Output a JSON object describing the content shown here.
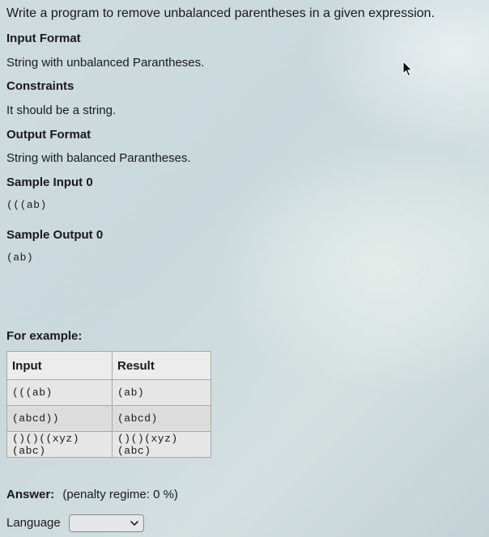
{
  "problem": {
    "statement": "Write a program to remove unbalanced parentheses in a given expression.",
    "input_format_heading": "Input Format",
    "input_format_text": "String with unbalanced Parantheses.",
    "constraints_heading": "Constraints",
    "constraints_text": "It should be a string.",
    "output_format_heading": "Output Format",
    "output_format_text": "String with balanced Parantheses.",
    "sample_input_heading": "Sample Input 0",
    "sample_input_text": "(((ab)",
    "sample_output_heading": "Sample Output 0",
    "sample_output_text": "(ab)"
  },
  "example": {
    "heading": "For example:",
    "columns": [
      "Input",
      "Result"
    ],
    "rows": [
      [
        "(((ab)",
        "(ab)"
      ],
      [
        "(abcd))",
        "(abcd)"
      ],
      [
        "()()((xyz)(abc)",
        "()()(xyz)(abc)"
      ]
    ]
  },
  "answer": {
    "label": "Answer:",
    "penalty": "(penalty regime: 0 %)"
  },
  "language": {
    "label": "Language",
    "selected": ""
  },
  "icons": {
    "cursor": "mouse-pointer-icon",
    "dropdown": "chevron-down-icon"
  }
}
